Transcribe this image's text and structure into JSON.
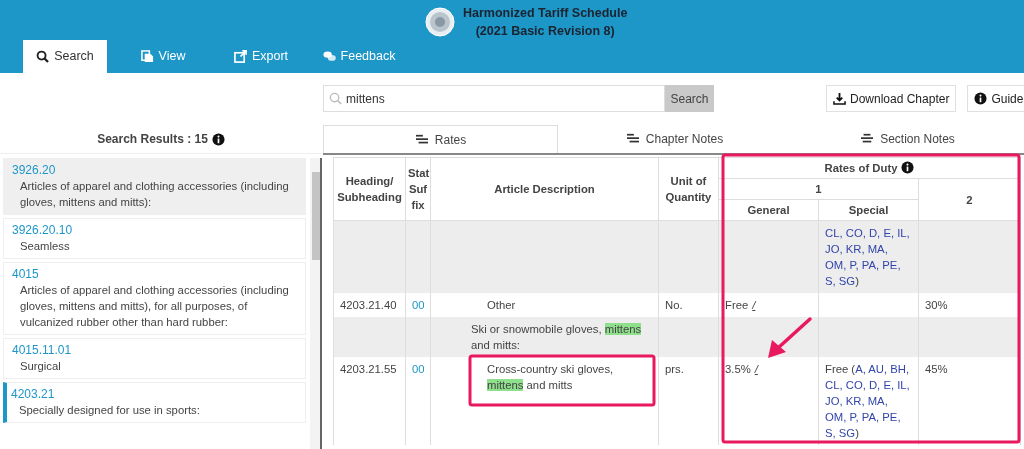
{
  "header": {
    "title_lines": [
      "Harmonized Tariff Schedule",
      "(2021 Basic Revision 8)"
    ]
  },
  "nav_tabs": [
    {
      "label": "Search",
      "selected": true
    },
    {
      "label": "View",
      "selected": false
    },
    {
      "label": "Export",
      "selected": false
    },
    {
      "label": "Feedback",
      "selected": false
    }
  ],
  "search": {
    "value": "mittens",
    "button": "Search"
  },
  "toolbar_buttons": [
    {
      "label": "Download Chapter"
    },
    {
      "label": "Guide"
    }
  ],
  "results": {
    "heading": "Search Results : 15",
    "items": [
      {
        "code": "3926.20",
        "description": "Articles of apparel and clothing accessories (including gloves, mittens and mitts):",
        "selected": true,
        "current": false
      },
      {
        "code": "3926.20.10",
        "description": "Seamless",
        "selected": false,
        "current": false
      },
      {
        "code": "4015",
        "description": "Articles of apparel and clothing accessories (including gloves, mittens and mitts), for all purposes, of vulcanized rubber other than hard rubber:",
        "selected": false,
        "current": false
      },
      {
        "code": "4015.11.01",
        "description": "Surgical",
        "selected": false,
        "current": false
      },
      {
        "code": "4203.21",
        "description": "Specially designed for use in sports:",
        "selected": false,
        "current": true
      }
    ]
  },
  "content_tabs": [
    {
      "label": "Rates",
      "selected": true
    },
    {
      "label": "Chapter Notes",
      "selected": false
    },
    {
      "label": "Section Notes",
      "selected": false
    }
  ],
  "table": {
    "columns": {
      "heading": "Heading/ Subheading",
      "suffix": "Stat Suf fix",
      "description": "Article Description",
      "unit": "Unit of Quantity",
      "rates": "Rates of Duty",
      "column_1": "1",
      "general": "General",
      "special": "Special",
      "column_2": "2"
    },
    "rows": [
      {
        "kind": "article",
        "shaded": true,
        "special": {
          "codes": "CL, CO, D, E, IL, JO, KR, MA, OM, P, PA, PE, S, SG",
          "suffix": ")"
        }
      },
      {
        "kind": "article",
        "shaded": false,
        "heading": "4203.21.40",
        "suffix": "00",
        "description": {
          "before": "Other"
        },
        "unit": "No.",
        "general": {
          "rate": "Free",
          "footnote": "/"
        },
        "column_2": "30%"
      },
      {
        "kind": "group",
        "shaded": true,
        "description": {
          "before": "Ski or snowmobile gloves, ",
          "highlight": "mittens",
          "after": " and mitts:"
        }
      },
      {
        "kind": "article",
        "shaded": false,
        "heading": "4203.21.55",
        "suffix": "00",
        "description": {
          "before": "Cross-country ski gloves, ",
          "highlight": "mittens",
          "after": " and mitts"
        },
        "unit": "prs.",
        "general": {
          "rate": "3.5%",
          "footnote": "/"
        },
        "special": {
          "prefix": "Free (",
          "codes": "A, AU, BH, CL, CO, D, E, IL, JO, KR, MA, OM, P, PA, PE, S, SG",
          "suffix": ")"
        },
        "column_2": "45%"
      }
    ]
  }
}
